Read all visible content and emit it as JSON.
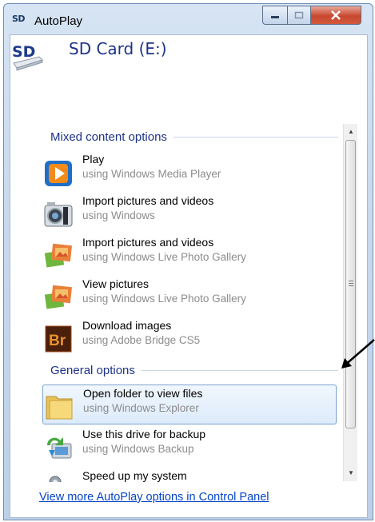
{
  "window": {
    "title": "AutoPlay",
    "title_icon_text": "SD",
    "controls": [
      "minimize",
      "maximize",
      "close"
    ]
  },
  "device": {
    "name": "SD Card (E:)",
    "icon_text": "SD"
  },
  "sections": [
    {
      "label": "Mixed content options",
      "items": [
        {
          "title": "Play",
          "subtitle": "using Windows Media Player",
          "icon": "media-player-icon",
          "selected": false
        },
        {
          "title": "Import pictures and videos",
          "subtitle": "using Windows",
          "icon": "camera-icon",
          "selected": false
        },
        {
          "title": "Import pictures and videos",
          "subtitle": "using Windows Live Photo Gallery",
          "icon": "photo-gallery-icon",
          "selected": false
        },
        {
          "title": "View pictures",
          "subtitle": "using Windows Live Photo Gallery",
          "icon": "photo-gallery-icon",
          "selected": false
        },
        {
          "title": "Download images",
          "subtitle": "using Adobe Bridge CS5",
          "icon": "adobe-bridge-icon",
          "icon_text": "Br",
          "selected": false
        }
      ]
    },
    {
      "label": "General options",
      "items": [
        {
          "title": "Open folder to view files",
          "subtitle": "using Windows Explorer",
          "icon": "folder-icon",
          "selected": true
        },
        {
          "title": "Use this drive for backup",
          "subtitle": "using Windows Backup",
          "icon": "backup-icon",
          "selected": false
        },
        {
          "title": "Speed up my system",
          "subtitle": "",
          "icon": "speed-up-icon",
          "selected": false
        }
      ]
    }
  ],
  "footer": {
    "link_text": "View more AutoPlay options in Control Panel"
  },
  "colors": {
    "accent_text": "#1e3287",
    "link": "#0645c8",
    "subtitle": "#8c8c8c",
    "selection_border": "#7da2ce"
  }
}
